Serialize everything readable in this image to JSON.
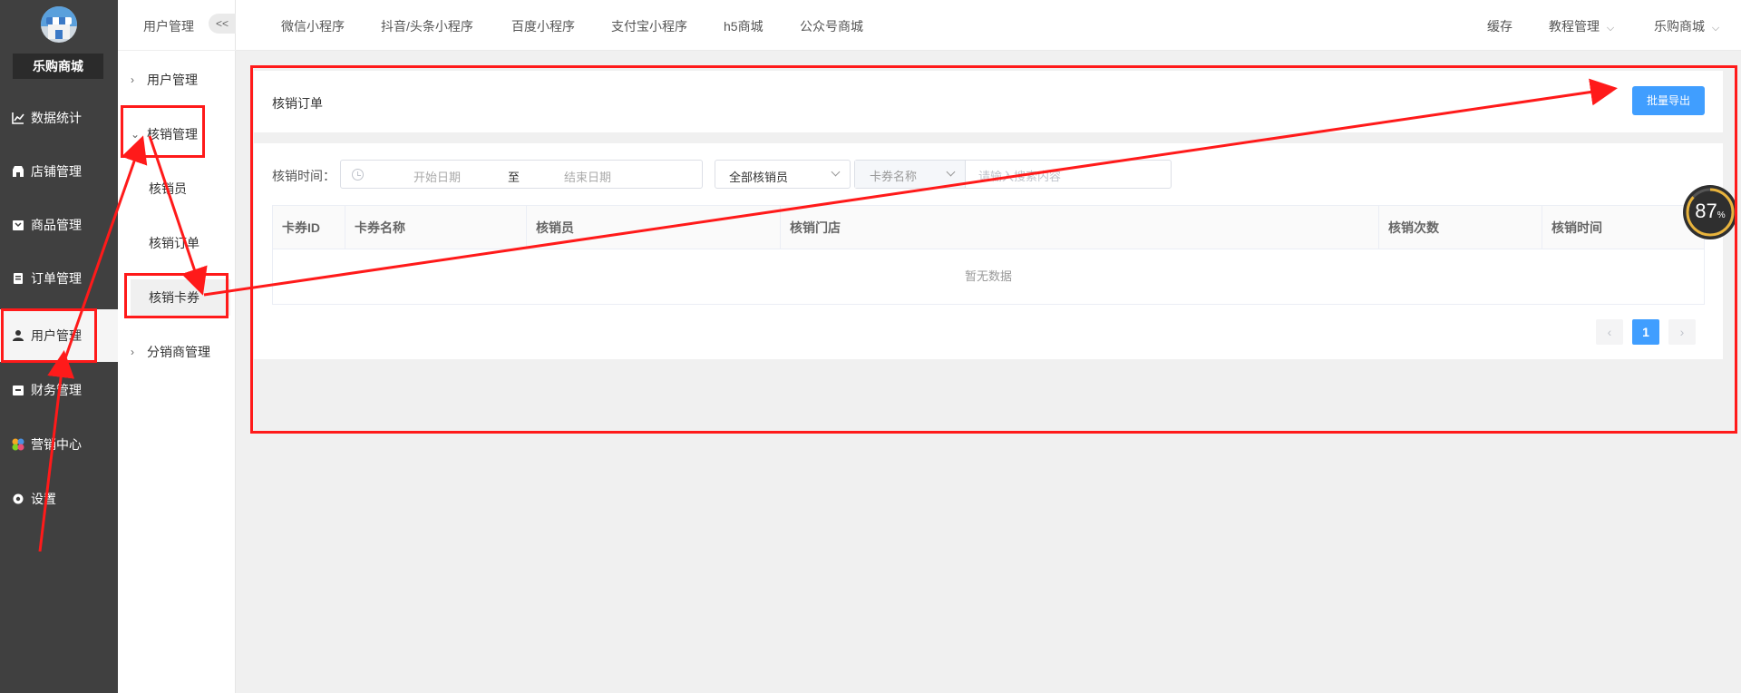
{
  "app": {
    "shop_name": "乐购商城"
  },
  "sidebar": {
    "items": [
      {
        "label": "数据统计",
        "icon": "chart-icon"
      },
      {
        "label": "店铺管理",
        "icon": "store-icon"
      },
      {
        "label": "商品管理",
        "icon": "goods-icon"
      },
      {
        "label": "订单管理",
        "icon": "order-icon"
      },
      {
        "label": "用户管理",
        "icon": "user-icon",
        "active": true
      },
      {
        "label": "财务管理",
        "icon": "finance-icon"
      },
      {
        "label": "营销中心",
        "icon": "marketing-icon"
      },
      {
        "label": "设置",
        "icon": "settings-icon"
      }
    ]
  },
  "subnav": {
    "title": "用户管理",
    "collapse_label": "<<",
    "groups": [
      {
        "label": "用户管理",
        "expanded": false
      },
      {
        "label": "核销管理",
        "expanded": true,
        "children": [
          "核销员",
          "核销订单",
          "核销卡券"
        ]
      },
      {
        "label": "分销商管理",
        "expanded": false
      }
    ],
    "active_child": "核销卡券"
  },
  "topnav": {
    "tabs": [
      "微信小程序",
      "抖音/头条小程序",
      "百度小程序",
      "支付宝小程序",
      "h5商城",
      "公众号商城"
    ],
    "right": {
      "cache": "缓存",
      "tutorial": "教程管理",
      "shop": "乐购商城"
    }
  },
  "page": {
    "title": "核销订单",
    "export_button": "批量导出",
    "filters": {
      "time_label": "核销时间：",
      "start_placeholder": "开始日期",
      "range_separator": "至",
      "end_placeholder": "结束日期",
      "verifier_select": "全部核销员",
      "search_type": "卡券名称",
      "search_placeholder": "请输入搜索内容"
    },
    "table": {
      "columns": [
        "卡券ID",
        "卡券名称",
        "核销员",
        "核销门店",
        "核销次数",
        "核销时间"
      ],
      "rows": [],
      "empty_text": "暂无数据"
    },
    "pagination": {
      "prev": "‹",
      "current": "1",
      "next": "›"
    }
  },
  "meter": {
    "value": "87",
    "unit": "%"
  },
  "colors": {
    "accent": "#409eff",
    "sidebar": "#404040",
    "annotation": "#ff1a1a"
  }
}
